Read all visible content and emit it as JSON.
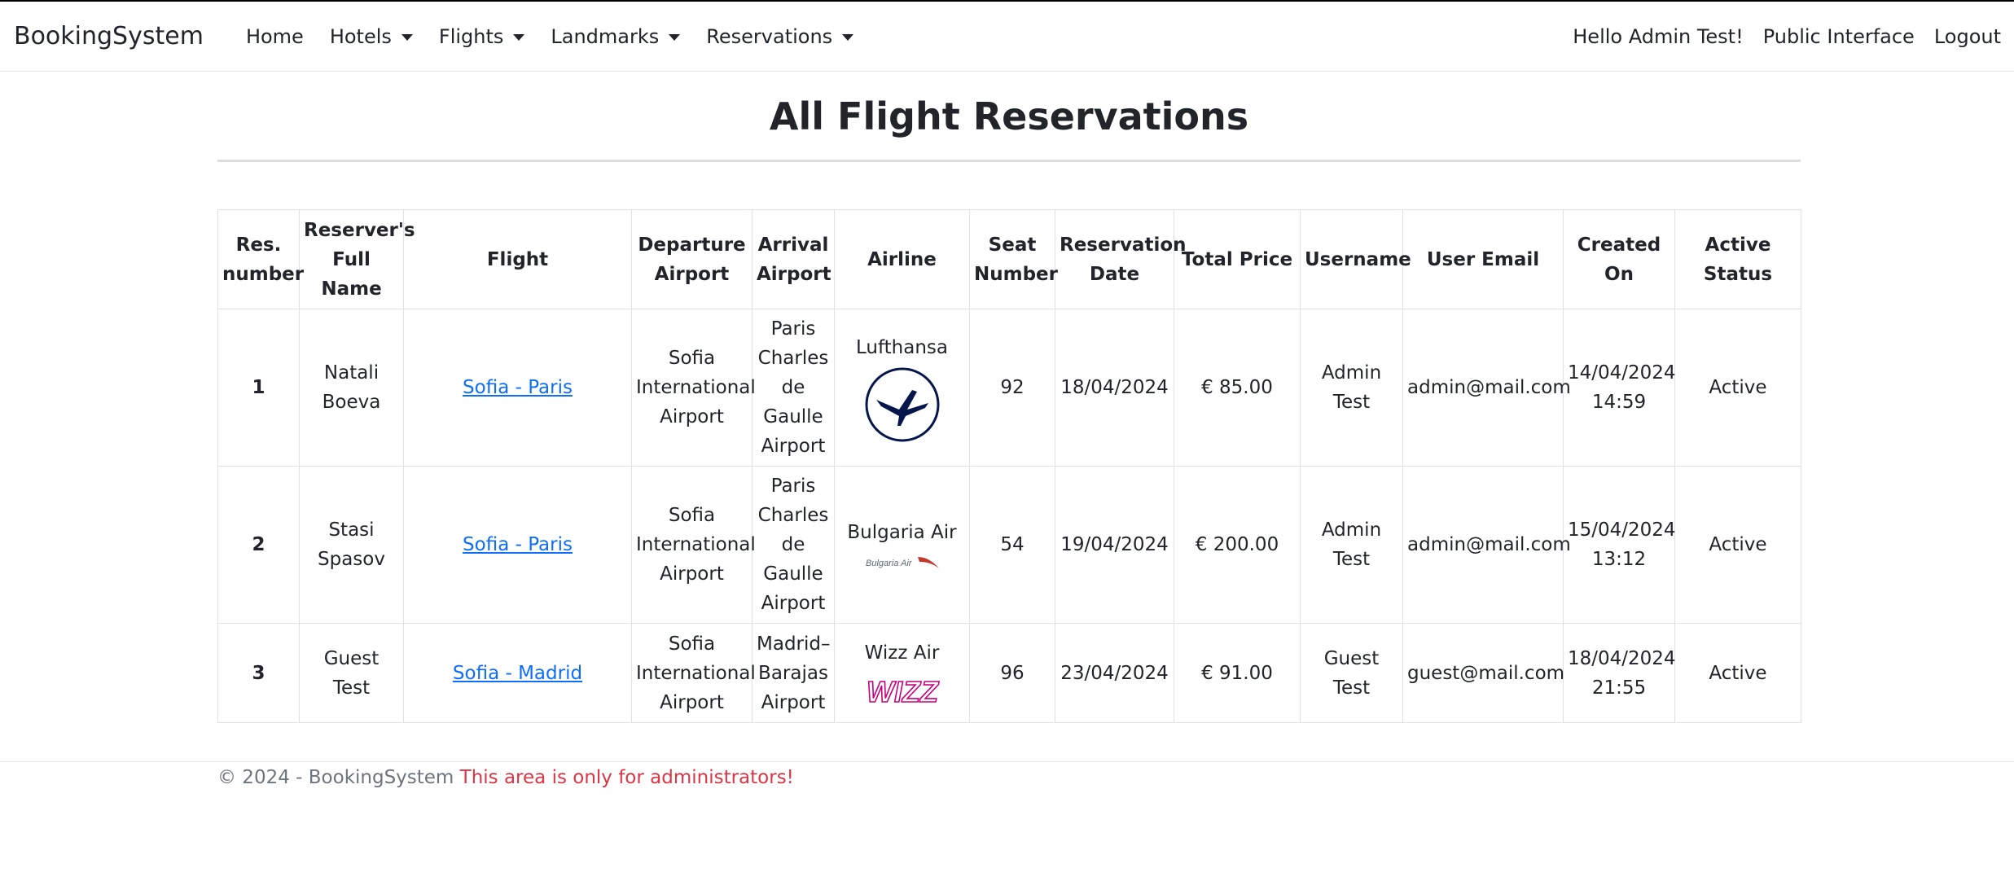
{
  "nav": {
    "brand": "BookingSystem",
    "items": [
      {
        "label": "Home",
        "dropdown": false
      },
      {
        "label": "Hotels",
        "dropdown": true
      },
      {
        "label": "Flights",
        "dropdown": true
      },
      {
        "label": "Landmarks",
        "dropdown": true
      },
      {
        "label": "Reservations",
        "dropdown": true
      }
    ],
    "greeting": "Hello Admin Test!",
    "public_interface": "Public Interface",
    "logout": "Logout"
  },
  "page": {
    "title": "All Flight Reservations"
  },
  "table": {
    "headers": [
      "Res. number",
      "Reserver's Full Name",
      "Flight",
      "Departure Airport",
      "Arrival Airport",
      "Airline",
      "Seat Number",
      "Reservation Date",
      "Total Price",
      "Username",
      "User Email",
      "Created On",
      "Active Status"
    ],
    "rows": [
      {
        "res_number": "1",
        "full_name": "Natali Boeva",
        "flight": "Sofia - Paris",
        "departure": "Sofia International Airport",
        "arrival": "Paris Charles de Gaulle Airport",
        "airline": "Lufthansa",
        "airline_logo": "lufthansa-logo",
        "seat": "92",
        "reservation_date": "18/04/2024",
        "total_price": "€ 85.00",
        "username": "Admin Test",
        "email": "admin@mail.com",
        "created_on": "14/04/2024 14:59",
        "status": "Active"
      },
      {
        "res_number": "2",
        "full_name": "Stasi Spasov",
        "flight": "Sofia - Paris",
        "departure": "Sofia International Airport",
        "arrival": "Paris Charles de Gaulle Airport",
        "airline": "Bulgaria Air",
        "airline_logo": "bulgaria-air-logo",
        "seat": "54",
        "reservation_date": "19/04/2024",
        "total_price": "€ 200.00",
        "username": "Admin Test",
        "email": "admin@mail.com",
        "created_on": "15/04/2024 13:12",
        "status": "Active"
      },
      {
        "res_number": "3",
        "full_name": "Guest Test",
        "flight": "Sofia - Madrid",
        "departure": "Sofia International Airport",
        "arrival": "Madrid–Barajas Airport",
        "airline": "Wizz Air",
        "airline_logo": "wizz-air-logo",
        "seat": "96",
        "reservation_date": "23/04/2024",
        "total_price": "€ 91.00",
        "username": "Guest Test",
        "email": "guest@mail.com",
        "created_on": "18/04/2024 21:55",
        "status": "Active"
      }
    ]
  },
  "logo_text": {
    "bulgaria_air": "Bulgaria Air",
    "wizz": "WIZZ"
  },
  "footer": {
    "copyright": "© 2024 - BookingSystem",
    "warning": "This area is only for administrators!"
  },
  "colors": {
    "link": "#0d6efd",
    "warning": "#dc3545",
    "muted": "#6c757d",
    "lufthansa": "#05164d",
    "bulgaria_air_swoosh": "#c0392b",
    "wizz": "#c6007e"
  }
}
